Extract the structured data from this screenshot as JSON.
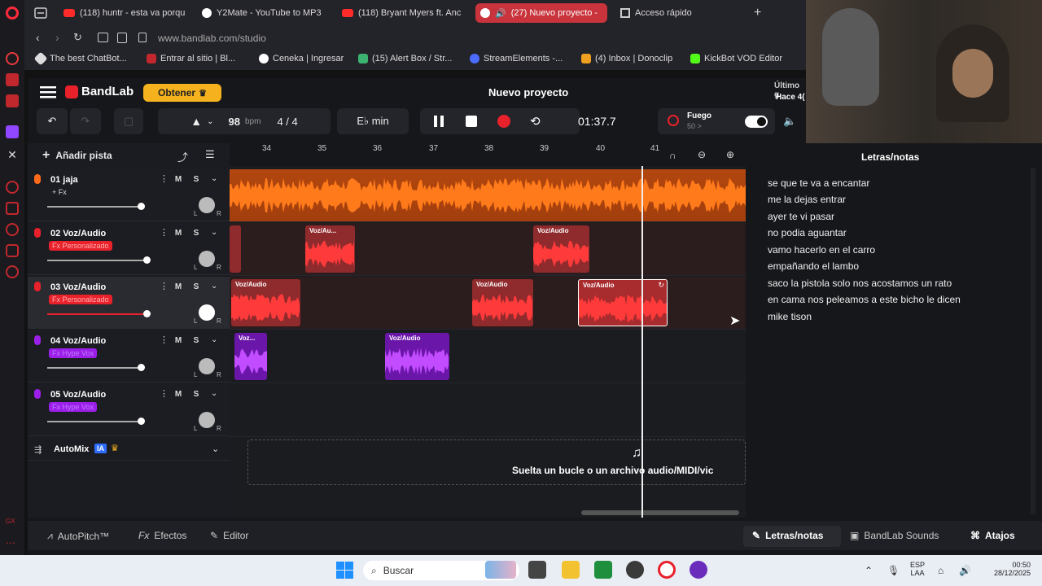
{
  "browser": {
    "tabs": [
      {
        "label": "(118) huntr - esta va porqu",
        "icon": "youtube-icon"
      },
      {
        "label": "Y2Mate - YouTube to MP3",
        "icon": "y2mate-icon"
      },
      {
        "label": "(118) Bryant Myers ft. Anc",
        "icon": "youtube-icon"
      },
      {
        "label": "(27) Nuevo proyecto -",
        "icon": "bandlab-icon"
      },
      {
        "label": "Acceso rápido",
        "icon": "grid-icon"
      }
    ],
    "url": "www.bandlab.com/studio",
    "bookmarks": [
      {
        "label": "The best ChatBot...",
        "color": "#dddddd"
      },
      {
        "label": "Entrar al sitio | Bl...",
        "color": "#c0282d"
      },
      {
        "label": "Ceneka | Ingresar",
        "color": "#ffffff"
      },
      {
        "label": "(15) Alert Box / Str...",
        "color": "#3cb371"
      },
      {
        "label": "StreamElements -...",
        "color": "#4b6cff"
      },
      {
        "label": "(4) Inbox | Donoclip",
        "color": "#f0a020"
      },
      {
        "label": "KickBot VOD Editor",
        "color": "#53fc18"
      }
    ]
  },
  "header": {
    "logo": "BandLab",
    "obtain_label": "Obtener",
    "project_title": "Nuevo proyecto",
    "last_saved": "Último g",
    "last_saved_time": "Hace 4("
  },
  "toolbar": {
    "bpm_value": "98",
    "bpm_unit": "bpm",
    "time_sig": "4 / 4",
    "key": "E♭ min",
    "time": "01:37.7",
    "fuego_label": "Fuego",
    "fuego_sub": "50 >",
    "fuego_on": true
  },
  "tracks_header": {
    "add_track": "Añadir pista"
  },
  "tracks": [
    {
      "name": "01 jaja",
      "fx": "+ Fx",
      "fx_color": "transparent",
      "icon_color": "#ff6a1a",
      "volume": 0.72,
      "selected": false
    },
    {
      "name": "02 Voz/Audio",
      "fx": "Fx Personalizado",
      "fx_color": "#e8212b",
      "icon_color": "#e8212b",
      "volume": 0.75,
      "selected": false
    },
    {
      "name": "03 Voz/Audio",
      "fx": "Fx Personalizado",
      "fx_color": "#e8212b",
      "icon_color": "#e8212b",
      "volume": 0.75,
      "selected": true
    },
    {
      "name": "04 Voz/Audio",
      "fx": "Fx Hype Vox",
      "fx_color": "#9b1fe8",
      "icon_color": "#9b1fe8",
      "volume": 0.72,
      "selected": false
    },
    {
      "name": "05 Voz/Audio",
      "fx": "Fx Hype Vox",
      "fx_color": "#9b1fe8",
      "icon_color": "#9b1fe8",
      "volume": 0.72,
      "selected": false
    }
  ],
  "ms": {
    "mute": "M",
    "solo": "S",
    "left": "L",
    "right": "R"
  },
  "automix": {
    "label": "AutoMix",
    "badge": "IA"
  },
  "ruler": [
    "34",
    "35",
    "36",
    "37",
    "38",
    "39",
    "40",
    "41"
  ],
  "clip_label": "Voz/Audio",
  "clip_label_short_a": "Voz/Au...",
  "clip_label_short_b": "Voz...",
  "drop_text": "Suelta un bucle o un archivo audio/MIDI/vic",
  "lyrics": {
    "title": "Letras/notas",
    "lines": [
      "se que te va a encantar",
      "me la dejas  entrar",
      "ayer te vi pasar",
      "no podia aguantar",
      "vamo hacerlo en el carro",
      "empañando el lambo",
      "saco la pistola solo nos acostamos un rato",
      "en cama nos peleamos a este bicho le dicen",
      "mike tison"
    ]
  },
  "bottom": {
    "autopitch": "AutoPitch™",
    "effects": "Efectos",
    "editor": "Editor",
    "lyrics_tab": "Letras/notas",
    "sounds": "BandLab Sounds",
    "shortcuts": "Atajos"
  },
  "taskbar": {
    "search": "Buscar",
    "lang": "ESP",
    "lang_sub": "LAA",
    "time": "00:50",
    "date": "28/12/2025"
  },
  "colors": {
    "orange": "#ff6a1a",
    "red": "#e8212b",
    "purple": "#9b1fe8",
    "accent": "#f5b21e"
  }
}
